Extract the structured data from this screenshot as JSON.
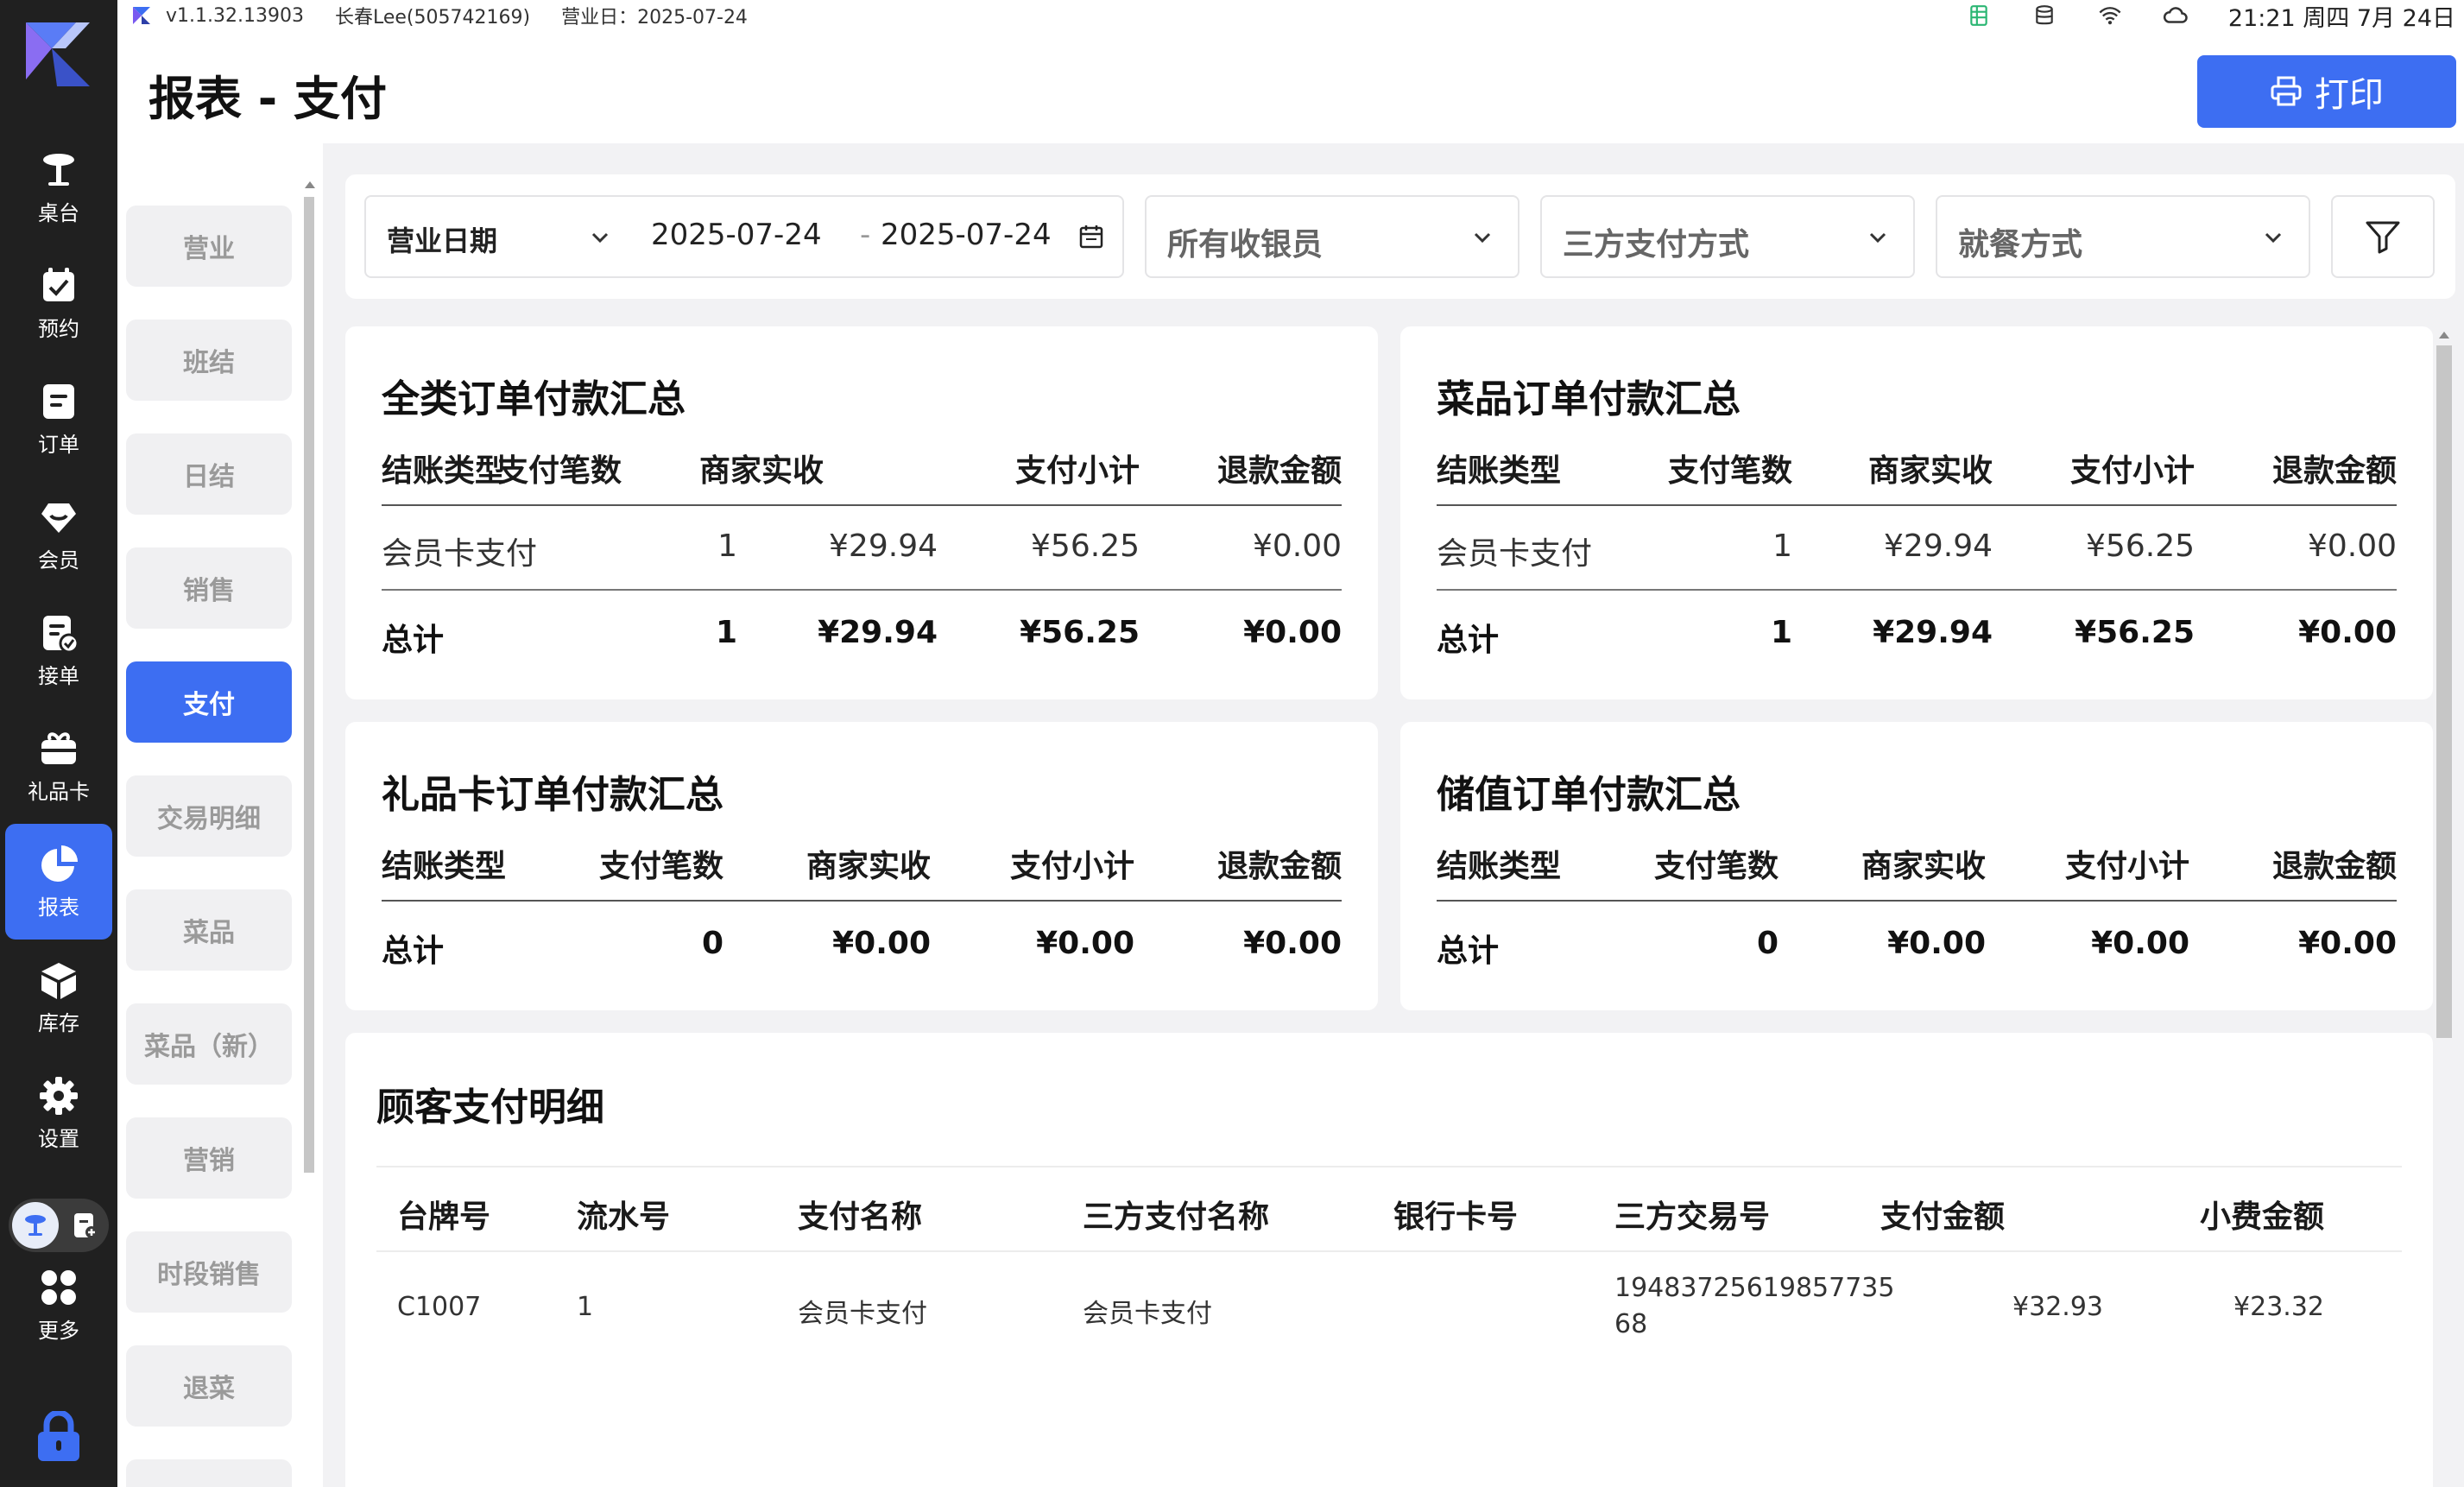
{
  "status_bar": {
    "version": "v1.1.32.13903",
    "user": "长春Lee(505742169)",
    "business_day": "营业日：2025-07-24",
    "clock": "21:21 周四 7月 24日"
  },
  "nav": {
    "items": [
      {
        "label": "桌台",
        "icon": "table-icon"
      },
      {
        "label": "预约",
        "icon": "calendar-check-icon"
      },
      {
        "label": "订单",
        "icon": "order-icon"
      },
      {
        "label": "会员",
        "icon": "member-icon"
      },
      {
        "label": "接单",
        "icon": "receive-order-icon"
      },
      {
        "label": "礼品卡",
        "icon": "gift-card-icon"
      },
      {
        "label": "报表",
        "icon": "pie-chart-icon"
      },
      {
        "label": "库存",
        "icon": "box-icon"
      },
      {
        "label": "设置",
        "icon": "gear-icon"
      },
      {
        "label": "更多",
        "icon": "grid-icon"
      }
    ],
    "active_index": 6
  },
  "header": {
    "title": "报表 - 支付",
    "print_label": "打印"
  },
  "report_menu": {
    "items": [
      "营业",
      "班结",
      "日结",
      "销售",
      "支付",
      "交易明细",
      "菜品",
      "菜品（新）",
      "营销",
      "时段销售",
      "退菜"
    ],
    "active": "支付"
  },
  "filters": {
    "date_type": "营业日期",
    "date_from": "2025-07-24",
    "date_sep": "-",
    "date_to": "2025-07-24",
    "cashier": "所有收银员",
    "third_party": "三方支付方式",
    "dining": "就餐方式"
  },
  "summary_cards": [
    {
      "title": "全类订单付款汇总",
      "headers": [
        "结账类型",
        "支付笔数",
        "商家实收",
        "支付小计",
        "退款金额"
      ],
      "rows": [
        [
          "会员卡支付",
          "1",
          "¥29.94",
          "¥56.25",
          "¥0.00"
        ]
      ],
      "total": [
        "总计",
        "1",
        "¥29.94",
        "¥56.25",
        "¥0.00"
      ]
    },
    {
      "title": "菜品订单付款汇总",
      "headers": [
        "结账类型",
        "支付笔数",
        "商家实收",
        "支付小计",
        "退款金额"
      ],
      "rows": [
        [
          "会员卡支付",
          "1",
          "¥29.94",
          "¥56.25",
          "¥0.00"
        ]
      ],
      "total": [
        "总计",
        "1",
        "¥29.94",
        "¥56.25",
        "¥0.00"
      ]
    },
    {
      "title": "礼品卡订单付款汇总",
      "headers": [
        "结账类型",
        "支付笔数",
        "商家实收",
        "支付小计",
        "退款金额"
      ],
      "rows": [],
      "total": [
        "总计",
        "0",
        "¥0.00",
        "¥0.00",
        "¥0.00"
      ]
    },
    {
      "title": "储值订单付款汇总",
      "headers": [
        "结账类型",
        "支付笔数",
        "商家实收",
        "支付小计",
        "退款金额"
      ],
      "rows": [],
      "total": [
        "总计",
        "0",
        "¥0.00",
        "¥0.00",
        "¥0.00"
      ]
    }
  ],
  "detail": {
    "title": "顾客支付明细",
    "headers": [
      "台牌号",
      "流水号",
      "支付名称",
      "三方支付名称",
      "银行卡号",
      "三方交易号",
      "支付金额",
      "小费金额"
    ],
    "rows": [
      {
        "table_no": "C1007",
        "serial": "1",
        "pay_name": "会员卡支付",
        "third_name": "会员卡支付",
        "bank_card": "",
        "trade_no_line1": "19483725619857735",
        "trade_no_line2": "68",
        "amount": "¥32.93",
        "tip": "¥23.32"
      }
    ]
  },
  "colors": {
    "accent": "#3d6ef2",
    "nav_bg": "#202020",
    "page_bg": "#f2f2f4"
  }
}
